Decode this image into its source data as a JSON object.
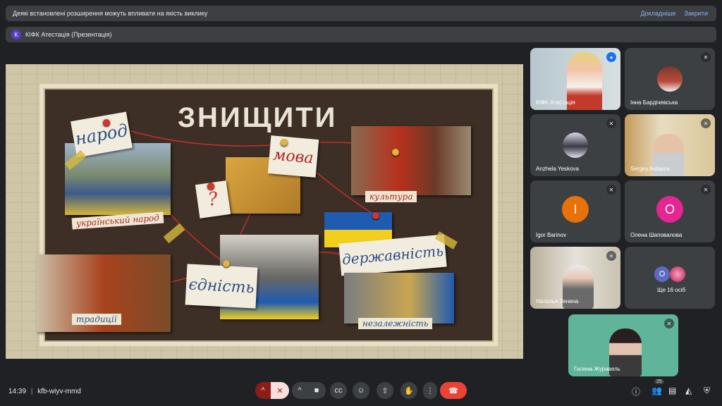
{
  "banner": {
    "message": "Деякі встановлені розширення можуть впливати на якість виклику",
    "more": "Докладніше",
    "close": "Закрити"
  },
  "presentation": {
    "avatar": "K",
    "title": "КІФК Атестація (Презентація)"
  },
  "slide": {
    "title": "ЗНИЩИТИ",
    "notes": {
      "people": "народ",
      "language": "мова",
      "question": "?",
      "unity": "єдність",
      "statehood": "державність"
    },
    "labels": {
      "ukr_people": "український народ",
      "culture": "культура",
      "traditions": "традиції",
      "independence": "незалежність"
    }
  },
  "participants": [
    {
      "name": "КІФК Атестація",
      "initial": ""
    },
    {
      "name": "Інна Бардічевська",
      "initial": ""
    },
    {
      "name": "Anzhela Yeskova",
      "initial": ""
    },
    {
      "name": "Sergey Astapov",
      "initial": ""
    },
    {
      "name": "Igor Barinov",
      "initial": "I"
    },
    {
      "name": "Олена Шаповалова",
      "initial": "O"
    },
    {
      "name": "Наталья Зенина",
      "initial": ""
    },
    {
      "name": "Ще 16 осіб",
      "initial": "O"
    },
    {
      "name": "Галина Журавель",
      "initial": ""
    }
  ],
  "colors": {
    "igor": "#e8710a",
    "olena": "#e52592",
    "more": "#5c6bc0",
    "end_call": "#ea4335"
  },
  "bottom": {
    "time": "14:39",
    "meeting_code": "kfb-wiyv-mmd",
    "people_count": "25"
  }
}
